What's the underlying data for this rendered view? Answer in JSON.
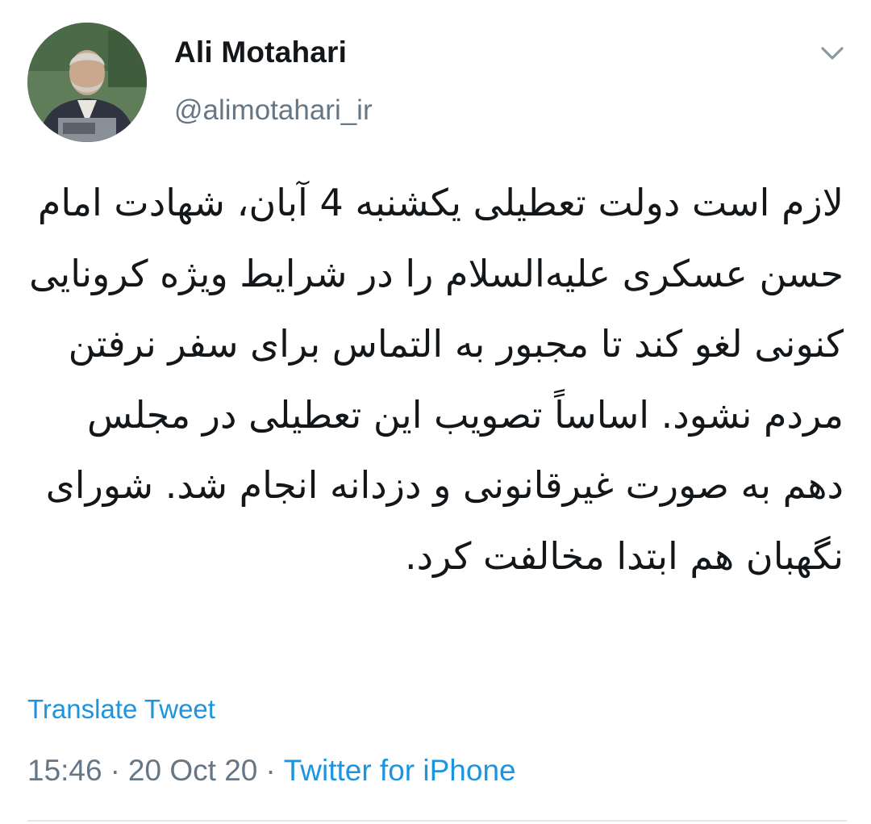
{
  "tweet": {
    "author": {
      "display_name": "Ali Motahari",
      "handle": "@alimotahari_ir",
      "avatar_icon": "profile-photo"
    },
    "menu_icon": "chevron-down-icon",
    "text": "لازم است دولت تعطیلی یکشنبه 4 آبان، شهادت امام حسن عسکری علیه‌السلام را در شرایط ویژه کرونایی کنونی لغو کند تا مجبور به التماس برای سفر نرفتن مردم نشود. اساساً تصویب این تعطیلی در مجلس دهم به صورت غیرقانونی و دزدانه انجام شد. شورای نگهبان هم ابتدا مخالفت کرد.",
    "translate_label": "Translate Tweet",
    "time": "15:46",
    "date": "20 Oct 20",
    "separator": "·",
    "source": "Twitter for iPhone"
  },
  "colors": {
    "text": "#14171a",
    "secondary": "#657786",
    "link": "#1b95e0",
    "divider": "#e1e8ed"
  }
}
